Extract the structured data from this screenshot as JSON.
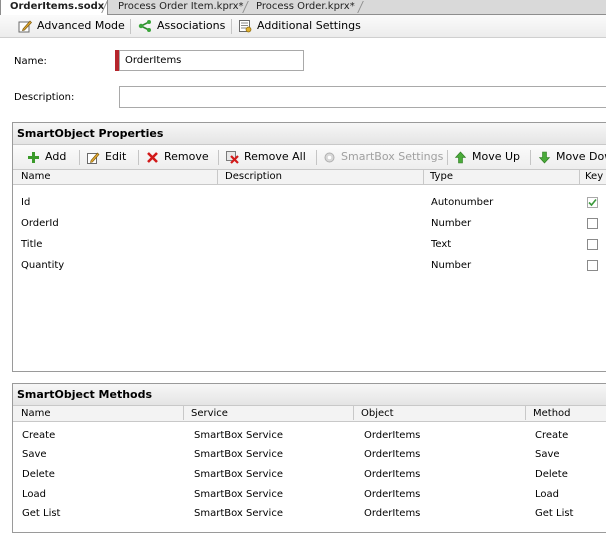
{
  "tabs": [
    {
      "label": "OrderItems.sodx",
      "active": true
    },
    {
      "label": "Process Order Item.kprx*",
      "active": false
    },
    {
      "label": "Process Order.kprx*",
      "active": false
    }
  ],
  "toolbar": {
    "advanced_mode": "Advanced Mode",
    "associations": "Associations",
    "additional_settings": "Additional Settings"
  },
  "form": {
    "name_label": "Name:",
    "name_value": "OrderItems",
    "description_label": "Description:",
    "description_value": ""
  },
  "properties": {
    "title": "SmartObject Properties",
    "buttons": {
      "add": "Add",
      "edit": "Edit",
      "remove": "Remove",
      "remove_all": "Remove All",
      "smartbox_settings": "SmartBox Settings",
      "move_up": "Move Up",
      "move_down": "Move Dow"
    },
    "columns": [
      "Name",
      "Description",
      "Type",
      "Key"
    ],
    "rows": [
      {
        "name": "Id",
        "description": "",
        "type": "Autonumber",
        "key": true
      },
      {
        "name": "OrderId",
        "description": "",
        "type": "Number",
        "key": false
      },
      {
        "name": "Title",
        "description": "",
        "type": "Text",
        "key": false
      },
      {
        "name": "Quantity",
        "description": "",
        "type": "Number",
        "key": false
      }
    ]
  },
  "methods": {
    "title": "SmartObject Methods",
    "columns": [
      "Name",
      "Service",
      "Object",
      "Method"
    ],
    "rows": [
      {
        "name": "Create",
        "service": "SmartBox Service",
        "object": "OrderItems",
        "method": "Create"
      },
      {
        "name": "Save",
        "service": "SmartBox Service",
        "object": "OrderItems",
        "method": "Save"
      },
      {
        "name": "Delete",
        "service": "SmartBox Service",
        "object": "OrderItems",
        "method": "Delete"
      },
      {
        "name": "Load",
        "service": "SmartBox Service",
        "object": "OrderItems",
        "method": "Load"
      },
      {
        "name": "Get List",
        "service": "SmartBox Service",
        "object": "OrderItems",
        "method": "Get List"
      }
    ]
  },
  "colors": {
    "required_marker": "#b5252c",
    "add_green": "#3a9a2a",
    "remove_red": "#d21a1a",
    "check_green": "#3c9a3c"
  }
}
